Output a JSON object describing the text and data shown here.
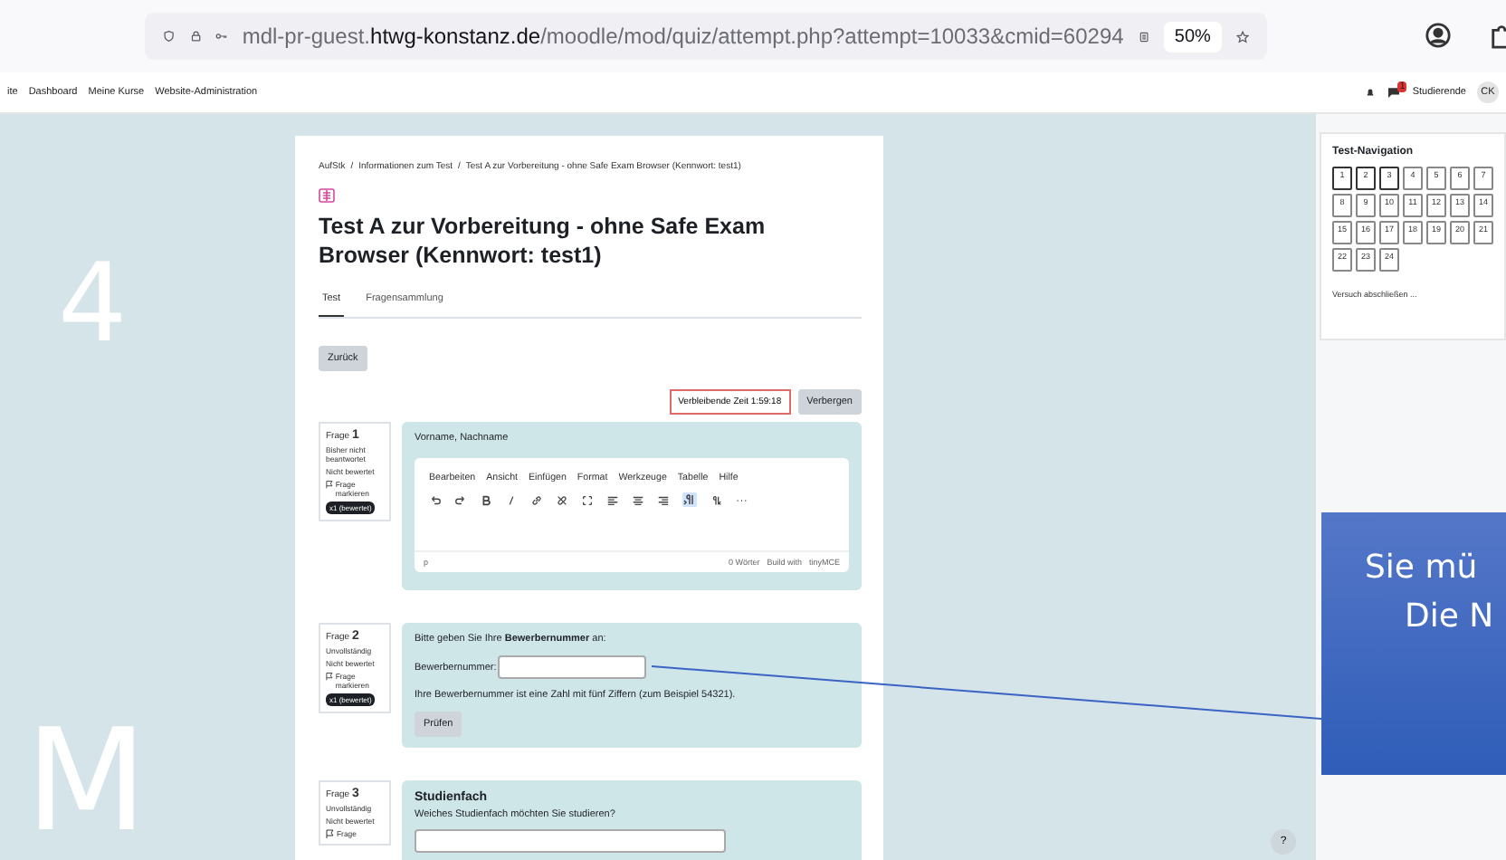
{
  "browser": {
    "url_host_prefix": "mdl-pr-guest.",
    "url_host": "htwg-konstanz.de",
    "url_path": "/moodle/mod/quiz/attempt.php?attempt=10033&cmid=60294",
    "zoom": "50%"
  },
  "top_nav": {
    "items": [
      "ite",
      "Dashboard",
      "Meine Kurse",
      "Website-Administration"
    ],
    "role": "Studierende",
    "avatar": "CK",
    "notification_count": "1"
  },
  "background_letters": [
    "4",
    "M"
  ],
  "breadcrumb_separator": "/",
  "breadcrumb": [
    "AufStk",
    "Informationen zum Test",
    "Test A zur Vorbereitung - ohne Safe Exam Browser (Kennwort: test1)"
  ],
  "title": "Test A zur Vorbereitung - ohne Safe Exam Browser (Kennwort: test1)",
  "tabs": [
    {
      "label": "Test",
      "selected": true
    },
    {
      "label": "Fragensammlung",
      "selected": false
    }
  ],
  "back_button": "Zurück",
  "timer": {
    "text": "Verbleibende Zeit 1:59:18",
    "hide_button": "Verbergen"
  },
  "questions": [
    {
      "kind": "essay",
      "label": "Frage",
      "number": "1",
      "status": "Bisher nicht beantwortet",
      "grading": "Nicht bewertet",
      "flag": "Frage markieren",
      "badge": "x1 (bewertet)",
      "prompt": "Vorname, Nachname",
      "menu": [
        "Bearbeiten",
        "Ansicht",
        "Einfügen",
        "Format",
        "Werkzeuge",
        "Tabelle",
        "Hilfe"
      ],
      "path": "p",
      "word_count": "0 Wörter",
      "built_with": "Build with",
      "brand": "tinyMCE"
    },
    {
      "kind": "shortanswer",
      "label": "Frage",
      "number": "2",
      "status": "Unvollständig",
      "grading": "Nicht bewertet",
      "flag": "Frage markieren",
      "badge": "x1 (bewertet)",
      "prompt": "Bitte geben Sie Ihre **Bewerbernummer** an:",
      "field_label": "Bewerbernummer:",
      "hint": "Ihre Bewerbernummer ist eine Zahl mit fünf Ziffern (zum Beispiel 54321).",
      "check_button": "Prüfen"
    },
    {
      "kind": "heading",
      "label": "Frage",
      "number": "3",
      "status": "Unvollständig",
      "grading": "Nicht bewertet",
      "flag": "Frage",
      "heading": "Studienfach",
      "prompt": "Weiches Studienfach möchten Sie studieren?"
    }
  ],
  "test_navigation": {
    "title": "Test-Navigation",
    "buttons": [
      {
        "label": "1",
        "visited": true
      },
      {
        "label": "2",
        "visited": true
      },
      {
        "label": "3",
        "visited": true
      },
      {
        "label": "4",
        "visited": false
      },
      {
        "label": "5",
        "visited": false
      },
      {
        "label": "6",
        "visited": false
      },
      {
        "label": "7",
        "visited": false
      },
      {
        "label": "8",
        "visited": false
      },
      {
        "label": "9",
        "visited": false
      },
      {
        "label": "10",
        "visited": false
      },
      {
        "label": "11",
        "visited": false
      },
      {
        "label": "12",
        "visited": false
      },
      {
        "label": "13",
        "visited": false
      },
      {
        "label": "14",
        "visited": false
      },
      {
        "label": "15",
        "visited": false
      },
      {
        "label": "16",
        "visited": false
      },
      {
        "label": "17",
        "visited": false
      },
      {
        "label": "18",
        "visited": false
      },
      {
        "label": "19",
        "visited": false
      },
      {
        "label": "20",
        "visited": false
      },
      {
        "label": "21",
        "visited": false
      },
      {
        "label": "22",
        "visited": false
      },
      {
        "label": "23",
        "visited": false
      },
      {
        "label": "24",
        "visited": false
      }
    ],
    "finish_link": "Versuch abschließen ..."
  },
  "callout": {
    "lines": [
      "Sie mü",
      "Die N"
    ]
  },
  "help_button": "?"
}
